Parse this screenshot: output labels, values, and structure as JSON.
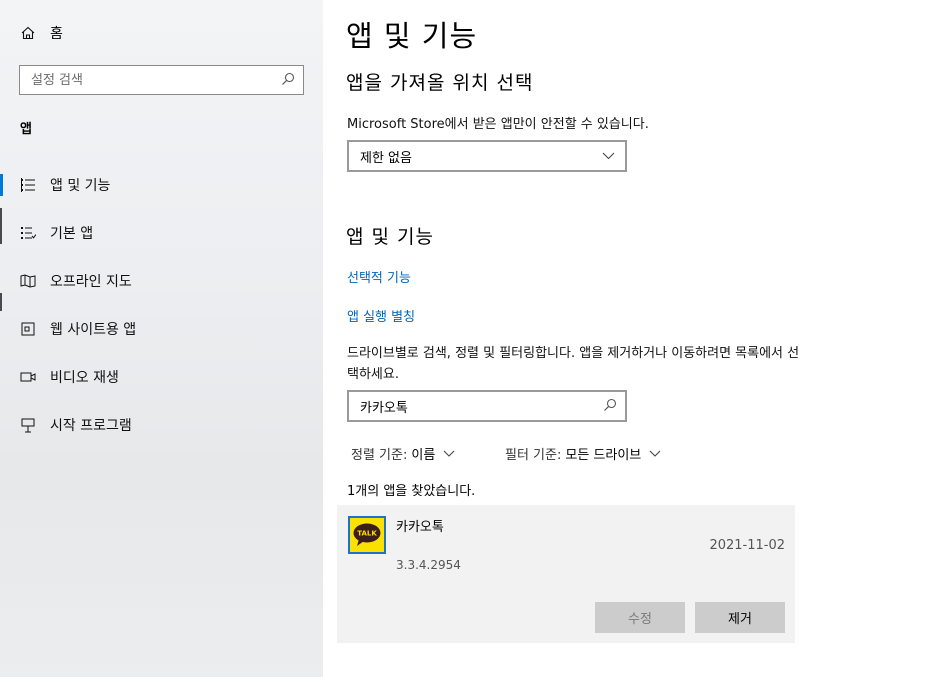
{
  "sidebar": {
    "home_label": "홈",
    "search_placeholder": "설정 검색",
    "section_label": "앱",
    "items": [
      {
        "label": "앱 및 기능",
        "icon": "list-icon"
      },
      {
        "label": "기본 앱",
        "icon": "list-check-icon"
      },
      {
        "label": "오프라인 지도",
        "icon": "map-icon"
      },
      {
        "label": "웹 사이트용 앱",
        "icon": "website-icon"
      },
      {
        "label": "비디오 재생",
        "icon": "video-icon"
      },
      {
        "label": "시작 프로그램",
        "icon": "startup-icon"
      }
    ],
    "selected_index": 0
  },
  "main": {
    "title": "앱 및 기능",
    "source_heading": "앱을 가져올 위치 선택",
    "source_description": "Microsoft Store에서 받은 앱만이 안전할 수 있습니다.",
    "source_dropdown_value": "제한 없음",
    "apps_heading": "앱 및 기능",
    "link_optional_features": "선택적 기능",
    "link_app_aliases": "앱 실행 별칭",
    "search_description": "드라이브별로 검색, 정렬 및 필터링합니다. 앱을 제거하거나 이동하려면 목록에서 선택하세요.",
    "app_search_value": "카카오톡",
    "sort_label": "정렬 기준:",
    "sort_value": "이름",
    "filter_label": "필터 기준:",
    "filter_value": "모든 드라이브",
    "result_count": "1개의 앱을 찾았습니다.",
    "app": {
      "name": "카카오톡",
      "date": "2021-11-02",
      "version": "3.3.4.2954",
      "logo_text": "TALK",
      "modify_label": "수정",
      "remove_label": "제거"
    }
  },
  "colors": {
    "accent": "#0078d7",
    "link": "#0067b8",
    "kakao_yellow": "#fae100"
  }
}
